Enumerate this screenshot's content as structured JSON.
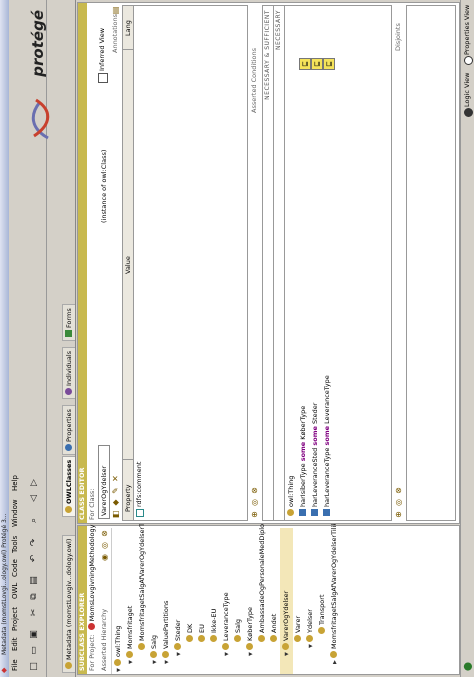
{
  "window": {
    "title": "Metadata (momstLovgi...ology.owl) Protégé 3..."
  },
  "menu": [
    "File",
    "Edit",
    "Project",
    "OWL",
    "Code",
    "Tools",
    "Window",
    "Help"
  ],
  "toolbar": [
    "new-icon",
    "open-icon",
    "save-icon",
    "cut-icon",
    "copy-icon",
    "paste-icon",
    "undo-icon",
    "redo-icon",
    "find-icon",
    "back-icon",
    "forward-icon"
  ],
  "logo": {
    "text": "protégé"
  },
  "tabs": [
    {
      "label": "Metadata (momstLovgiv...dology.owl)"
    },
    {
      "label": "OWLClasses"
    },
    {
      "label": "Properties"
    },
    {
      "label": "Individuals"
    },
    {
      "label": "Forms"
    }
  ],
  "subclass_explorer": {
    "header": "SUBCLASS EXPLORER",
    "project_label": "For Project:",
    "project_name": "MomsLovgivningMethodologyFramework",
    "hierarchy_label": "Asserted Hierarchy",
    "items": [
      {
        "label": "owl:Thing"
      },
      {
        "label": "Momsfritaget"
      },
      {
        "label": "MomsfritagetSalgAfVarerOgYdelserTilikke-EU"
      },
      {
        "label": "Salg"
      },
      {
        "label": "ValuePartitions"
      },
      {
        "label": "Steder"
      },
      {
        "label": "DK"
      },
      {
        "label": "EU"
      },
      {
        "label": "Ikke-EU"
      },
      {
        "label": "LeveranceType"
      },
      {
        "label": "Salg"
      },
      {
        "label": "KøberType"
      },
      {
        "label": "AmbassadeOgPersonaleMedDiplomatiskeR"
      },
      {
        "label": "Andet"
      },
      {
        "label": "VarerOgYdelser"
      },
      {
        "label": "Varer"
      },
      {
        "label": "Ydelser"
      },
      {
        "label": "Transport"
      },
      {
        "label": "MomsfritagetSalgAfVarerOgYdelserTilikke-EU"
      }
    ]
  },
  "class_editor": {
    "header": "CLASS EDITOR",
    "for_class_label": "For Class:",
    "class_name": "VarerOgYdelser",
    "instance_note": "(instance of owl:Class)",
    "inferred_view_label": "Inferred View",
    "annotations_label": "Annotations",
    "columns": [
      "Property",
      "Value",
      "Lang"
    ],
    "rows": [
      {
        "property": "rdfs:comment",
        "value": "",
        "lang": ""
      }
    ]
  },
  "conditions": {
    "header": "Asserted Conditions",
    "nec_suff_label": "NECESSARY & SUFFICIENT",
    "necessary_label": "NECESSARY",
    "items": [
      {
        "text": "owl:Thing",
        "kw": "",
        "rest": "",
        "tag": ""
      },
      {
        "text": "harIsiberType",
        "kw": "some",
        "rest": "KøberType",
        "tag": "⊑"
      },
      {
        "text": "harLeveranceSted",
        "kw": "some",
        "rest": "Steder",
        "tag": "⊑"
      },
      {
        "text": "harLeveranceType",
        "kw": "some",
        "rest": "LeveranceType",
        "tag": "⊑"
      }
    ]
  },
  "disjoints": {
    "label": "Disjoints"
  },
  "status": {
    "logic_view": "Logic View",
    "properties_view": "Properties View"
  },
  "colors": {
    "accent": "#c8b94f",
    "class_dot": "#c8a335",
    "selection": "#f3e7b8"
  }
}
